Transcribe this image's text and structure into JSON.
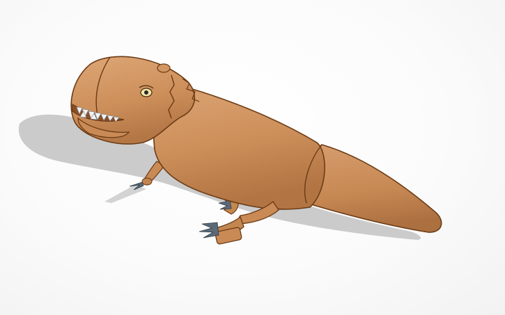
{
  "scene": {
    "subject": "cartoon-dinosaur-3d-model",
    "colors": {
      "background": "#ffffff",
      "shadow": "#cfcfcf",
      "body_fill": "#cf915c",
      "body_light": "#dca572",
      "body_dark": "#a96b3a",
      "outline": "#6b3a14",
      "teeth": "#f1f4f6",
      "claws": "#5c6a78",
      "eye": "#efe7a8"
    }
  }
}
